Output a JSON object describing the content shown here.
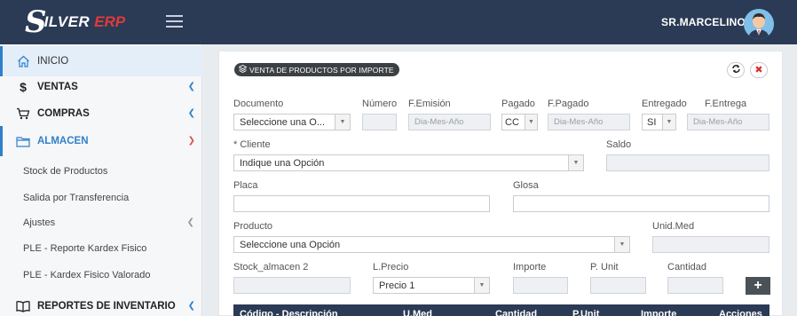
{
  "header": {
    "logo_s": "S",
    "logo_rest": "ILVER",
    "logo_erp": "ERP",
    "username": "SR.MARCELINO"
  },
  "sidebar": {
    "items": [
      {
        "label": "INICIO",
        "icon": "home-icon"
      },
      {
        "label": "VENTAS",
        "icon": "dollar-icon"
      },
      {
        "label": "COMPRAS",
        "icon": "cart-icon"
      },
      {
        "label": "ALMACEN",
        "icon": "folder-icon"
      }
    ],
    "sub_items": [
      {
        "label": "Stock de Productos"
      },
      {
        "label": "Salida por Transferencia"
      },
      {
        "label": "Ajustes"
      },
      {
        "label": "PLE - Reporte Kardex Fisico"
      },
      {
        "label": "PLE - Kardex Fisico Valorado"
      }
    ],
    "reportes": {
      "label": "REPORTES DE INVENTARIO",
      "icon": "book-icon"
    }
  },
  "form": {
    "badge": "VENTA DE PRODUCTOS POR IMPORTE",
    "labels": {
      "documento": "Documento",
      "numero": "Número",
      "f_emision": "F.Emisión",
      "pagado": "Pagado",
      "f_pagado": "F.Pagado",
      "entregado": "Entregado",
      "f_entrega": "F.Entrega",
      "cliente": "* Cliente",
      "saldo": "Saldo",
      "placa": "Placa",
      "glosa": "Glosa",
      "producto": "Producto",
      "unid_med": "Unid.Med",
      "stock_almacen": "Stock_almacen 2",
      "l_precio": "L.Precio",
      "importe": "Importe",
      "p_unit": "P. Unit",
      "cantidad": "Cantidad"
    },
    "values": {
      "documento": "Seleccione una O...",
      "f_emision_ph": "Dia-Mes-Año",
      "pagado": "CC",
      "f_pagado_ph": "Dia-Mes-Año",
      "entregado": "SI",
      "f_entrega_ph": "Dia-Mes-Año",
      "cliente": "Indique una Opción",
      "producto": "Seleccione una Opción",
      "l_precio": "Precio 1"
    },
    "add_button": "+"
  },
  "table": {
    "columns": [
      "Código - Descripción",
      "U.Med",
      "Cantidad",
      "P.Unit",
      "Importe",
      "Acciones"
    ]
  },
  "colors": {
    "topbar": "#2b3a55",
    "accent": "#2f80c9",
    "erp_red": "#e03a3a"
  }
}
